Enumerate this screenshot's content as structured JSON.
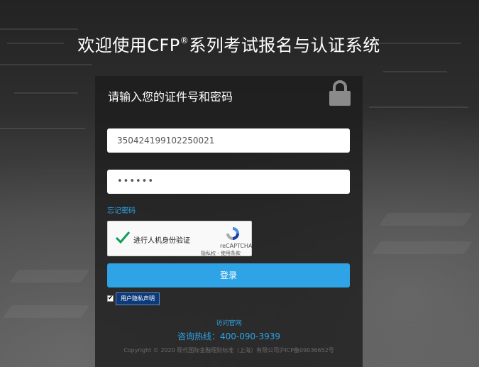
{
  "page": {
    "title_prefix": "欢迎使用CFP",
    "title_mark": "®",
    "title_suffix": "系列考试报名与认证系统"
  },
  "login": {
    "heading": "请输入您的证件号和密码",
    "id_value": "350424199102250021",
    "password_value": "••••••",
    "forgot_label": "忘记密码",
    "submit_label": "登录"
  },
  "captcha": {
    "label": "进行人机身份验证",
    "brand": "reCAPTCHA",
    "terms": "隐私权 - 使用条款"
  },
  "agreement": {
    "checked": true,
    "check_glyph": "✔",
    "privacy_label": "用户隐私声明"
  },
  "footer": {
    "site_link": "访问官网",
    "hotline": "咨询热线：400-090-3939",
    "copyright": "Copyright © 2020 现代国际金融理财标准（上海）有限公司沪ICP备09036652号"
  },
  "colors": {
    "accent": "#2ea3e6",
    "privacy_button": "#0d3b7a",
    "panel": "rgba(28,28,28,0.78)"
  },
  "icons": [
    "lock-icon",
    "checkmark-icon",
    "recaptcha-logo-icon"
  ]
}
